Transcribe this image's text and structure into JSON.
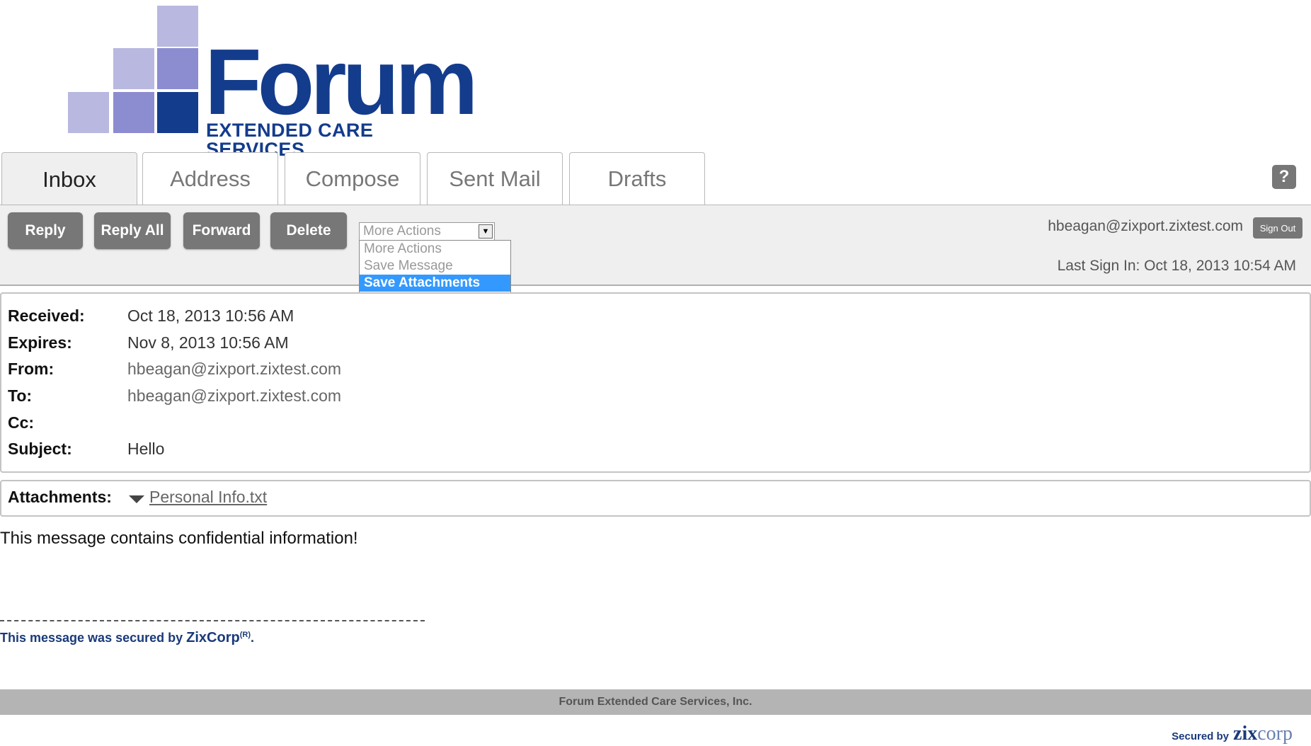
{
  "brand": {
    "name": "Forum",
    "tagline": "EXTENDED CARE SERVICES",
    "colors": {
      "primary": "#143c8c",
      "light": "#b8b8e0",
      "mid": "#7f7fcc"
    }
  },
  "tabs": [
    {
      "label": "Inbox",
      "active": true
    },
    {
      "label": "Address"
    },
    {
      "label": "Compose"
    },
    {
      "label": "Sent Mail"
    },
    {
      "label": "Drafts"
    }
  ],
  "help_label": "?",
  "toolbar": {
    "reply": "Reply",
    "reply_all": "Reply All",
    "forward": "Forward",
    "delete": "Delete",
    "more_actions": {
      "selected": "More Actions",
      "options": [
        "More Actions",
        "Save Message",
        "Save Attachments"
      ],
      "highlighted": "Save Attachments"
    }
  },
  "user": {
    "email": "hbeagan@zixport.zixtest.com",
    "sign_out": "Sign Out",
    "last_sign_in": "Last Sign In: Oct 18, 2013 10:54 AM"
  },
  "message": {
    "received_label": "Received:",
    "received": "Oct 18, 2013 10:56 AM",
    "expires_label": "Expires:",
    "expires": "Nov 8, 2013 10:56 AM",
    "from_label": "From:",
    "from": "hbeagan@zixport.zixtest.com",
    "to_label": "To:",
    "to": "hbeagan@zixport.zixtest.com",
    "cc_label": "Cc:",
    "cc": "",
    "subject_label": "Subject:",
    "subject": "Hello",
    "attachments_label": "Attachments:",
    "attachment": "Personal Info.txt",
    "body": "This message contains confidential information!",
    "secured_prefix": "This message was secured by",
    "secured_zix": "ZixCorp",
    "secured_reg": "(R)",
    "secured_suffix": "."
  },
  "footer": {
    "company": "Forum Extended Care Services, Inc.",
    "secured_by": "Secured by",
    "zix_bold": "zix",
    "zix_rest": "corp"
  }
}
